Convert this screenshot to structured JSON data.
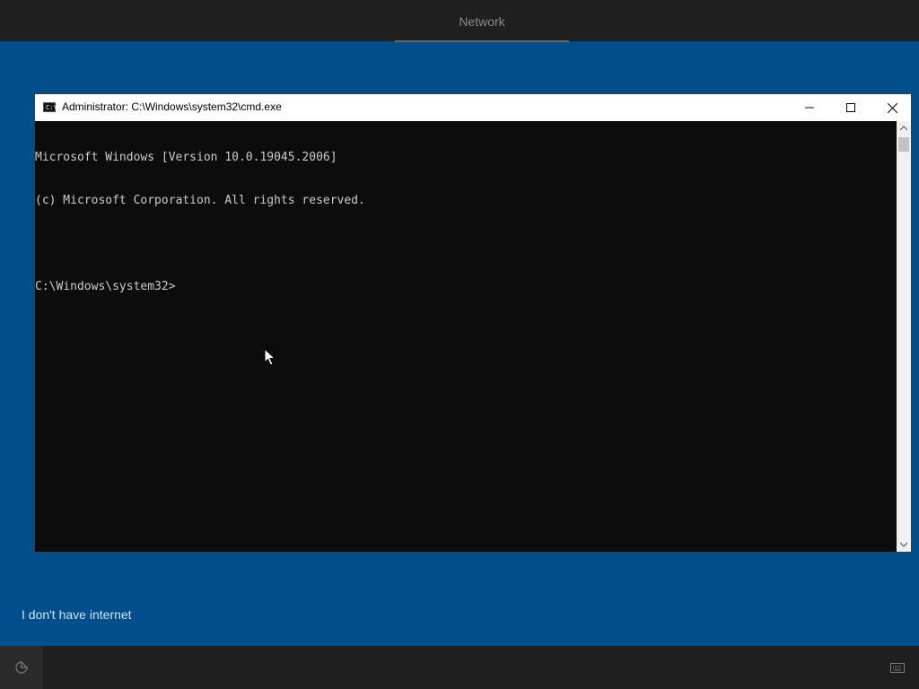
{
  "oobe": {
    "top_tab": "Network",
    "no_internet_link": "I don't have internet"
  },
  "cmd": {
    "title": "Administrator: C:\\Windows\\system32\\cmd.exe",
    "icon_glyph": "C:\\",
    "lines": [
      "Microsoft Windows [Version 10.0.19045.2006]",
      "(c) Microsoft Corporation. All rights reserved.",
      "",
      "C:\\Windows\\system32>"
    ]
  },
  "icons": {
    "minimize": "minimize-icon",
    "maximize": "maximize-icon",
    "close": "close-icon",
    "ease_of_access": "ease-of-access-icon",
    "keyboard": "keyboard-icon"
  },
  "colors": {
    "desktop_bg": "#004e8c",
    "console_bg": "#0c0c0c",
    "console_text": "#cccccc",
    "bar_bg": "#1f1f1f"
  }
}
